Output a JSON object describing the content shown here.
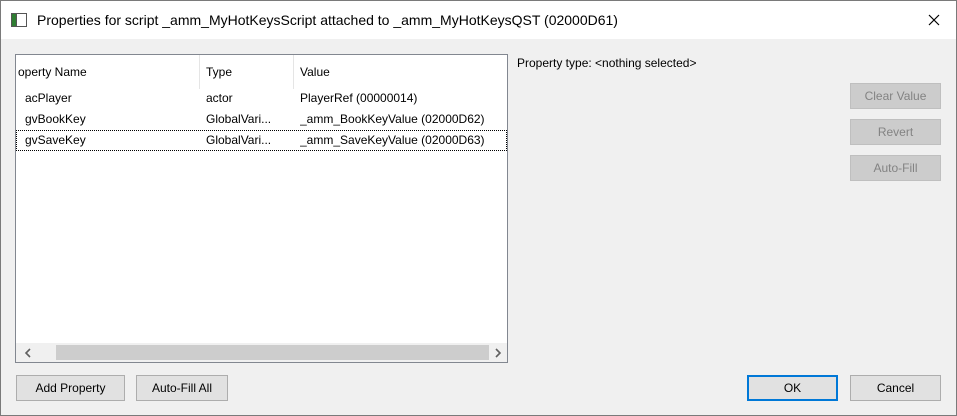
{
  "window": {
    "title": "Properties for script _amm_MyHotKeysScript attached to _amm_MyHotKeysQST (02000D61)"
  },
  "listview": {
    "columns": [
      "operty Name",
      "Type",
      "Value"
    ],
    "rows": [
      {
        "name": "acPlayer",
        "type": "actor",
        "value": "PlayerRef (00000014)"
      },
      {
        "name": "gvBookKey",
        "type": "GlobalVari...",
        "value": "_amm_BookKeyValue (02000D62)"
      },
      {
        "name": "gvSaveKey",
        "type": "GlobalVari...",
        "value": "_amm_SaveKeyValue (02000D63)"
      }
    ]
  },
  "property_type": "Property type: <nothing selected>",
  "side_buttons": {
    "clear_value": "Clear Value",
    "revert": "Revert",
    "auto_fill": "Auto-Fill"
  },
  "bottom_buttons": {
    "add_property": "Add Property",
    "auto_fill_all": "Auto-Fill All",
    "ok": "OK",
    "cancel": "Cancel"
  }
}
